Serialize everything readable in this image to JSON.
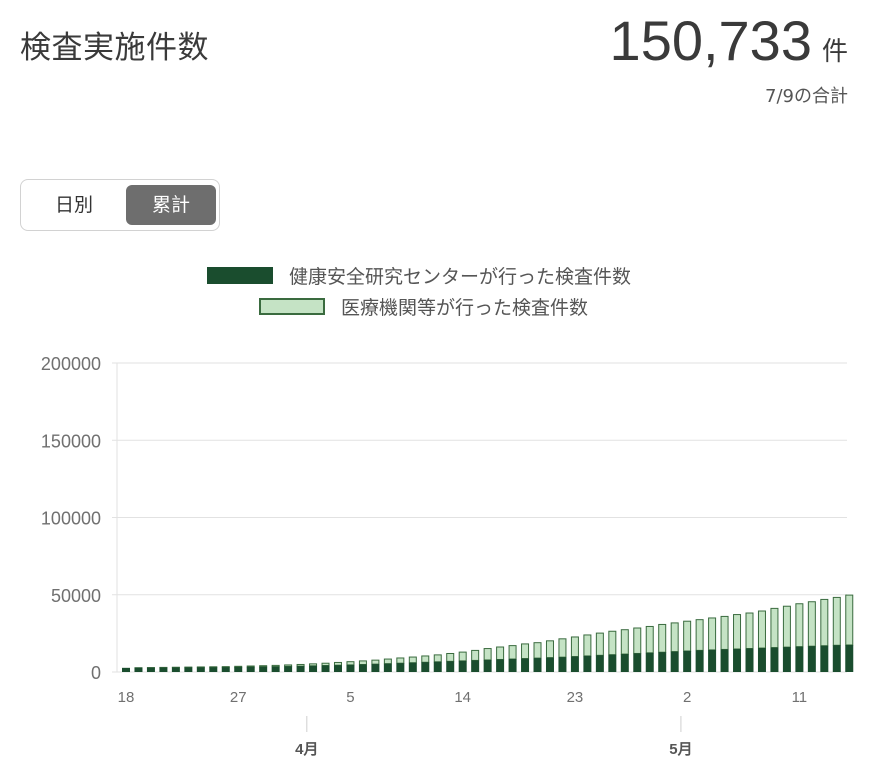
{
  "header": {
    "title": "検査実施件数",
    "total_value": "150,733",
    "total_unit": "件",
    "total_note": "7/9の合計"
  },
  "toggle": {
    "daily_label": "日別",
    "cumulative_label": "累計",
    "selected": "cumulative"
  },
  "colors": {
    "center_series": "#1a4d2e",
    "medical_series": "#c5e3c5",
    "medical_border": "#3a6b3f",
    "grid": "#e2e2e2",
    "axis_text": "#707070"
  },
  "chart_data": {
    "type": "bar",
    "stacked": true,
    "title": "",
    "xlabel": "",
    "ylabel": "",
    "ylim": [
      0,
      200000
    ],
    "y_ticks": [
      0,
      50000,
      100000,
      150000,
      200000
    ],
    "y_tick_labels": [
      "0",
      "50000",
      "100000",
      "150000",
      "200000"
    ],
    "x_ticks": [
      {
        "index": 0,
        "label": "18"
      },
      {
        "index": 9,
        "label": "27"
      },
      {
        "index": 18,
        "label": "5"
      },
      {
        "index": 27,
        "label": "14"
      },
      {
        "index": 36,
        "label": "23"
      },
      {
        "index": 45,
        "label": "2"
      },
      {
        "index": 54,
        "label": "11"
      }
    ],
    "month_labels": [
      {
        "index": 14,
        "label": "4月"
      },
      {
        "index": 44,
        "label": "5月"
      }
    ],
    "grid": true,
    "legend_position": "top",
    "series": [
      {
        "name": "健康安全研究センターが行った検査件数",
        "values": [
          2700,
          2750,
          2800,
          2850,
          2900,
          2950,
          3000,
          3050,
          3100,
          3200,
          3300,
          3400,
          3500,
          3650,
          3800,
          4000,
          4200,
          4400,
          4600,
          4850,
          5100,
          5400,
          5700,
          6000,
          6300,
          6600,
          6900,
          7200,
          7500,
          7800,
          8100,
          8400,
          8700,
          9000,
          9300,
          9600,
          10000,
          10400,
          10800,
          11200,
          11600,
          12000,
          12400,
          12800,
          13200,
          13600,
          14000,
          14300,
          14600,
          14900,
          15200,
          15500,
          15800,
          16100,
          16400,
          16700,
          17000,
          17300,
          17500
        ]
      },
      {
        "name": "医療機関等が行った検査件数",
        "values": [
          300,
          350,
          400,
          450,
          500,
          550,
          600,
          650,
          700,
          800,
          900,
          1000,
          1100,
          1250,
          1400,
          1600,
          1800,
          2100,
          2400,
          2650,
          2900,
          3300,
          3700,
          4000,
          4400,
          4800,
          5400,
          6000,
          6800,
          7700,
          8400,
          9000,
          9800,
          10300,
          11200,
          12200,
          13000,
          13900,
          14700,
          15500,
          16100,
          16800,
          17400,
          18300,
          18900,
          19600,
          20200,
          21000,
          21700,
          22600,
          23300,
          24300,
          25700,
          26800,
          28100,
          29100,
          30300,
          31300,
          32600
        ]
      }
    ]
  }
}
